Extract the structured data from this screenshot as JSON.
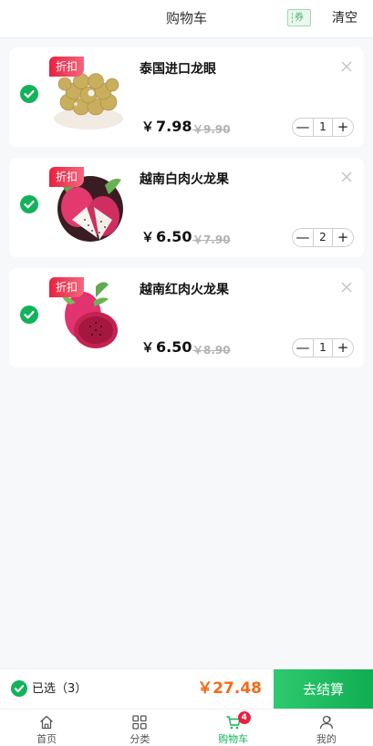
{
  "header": {
    "title": "购物车",
    "coupon_icon_text": "券",
    "clear_label": "清空"
  },
  "cart": {
    "items": [
      {
        "tag": "折扣",
        "name": "泰国进口龙眼",
        "currency": "￥",
        "price": "7.98",
        "original_price": "￥9.90",
        "quantity": "1",
        "image": "longan-icon"
      },
      {
        "tag": "折扣",
        "name": "越南白肉火龙果",
        "currency": "￥",
        "price": "6.50",
        "original_price": "￥7.90",
        "quantity": "2",
        "image": "white-dragon-fruit-icon"
      },
      {
        "tag": "折扣",
        "name": "越南红肉火龙果",
        "currency": "￥",
        "price": "6.50",
        "original_price": "￥8.90",
        "quantity": "1",
        "image": "red-dragon-fruit-icon"
      }
    ],
    "minus_symbol": "—",
    "plus_symbol": "+"
  },
  "checkout": {
    "selected_label": "已选（3）",
    "total": "￥27.48",
    "pay_label": "去结算"
  },
  "tabbar": {
    "tabs": [
      {
        "label": "首页",
        "icon": "home-icon"
      },
      {
        "label": "分类",
        "icon": "category-icon"
      },
      {
        "label": "购物车",
        "icon": "cart-icon",
        "badge": "4",
        "active": true
      },
      {
        "label": "我的",
        "icon": "user-icon"
      }
    ]
  },
  "colors": {
    "accent": "#12b35a",
    "price": "#f46a17",
    "tag": "#e8213f"
  }
}
